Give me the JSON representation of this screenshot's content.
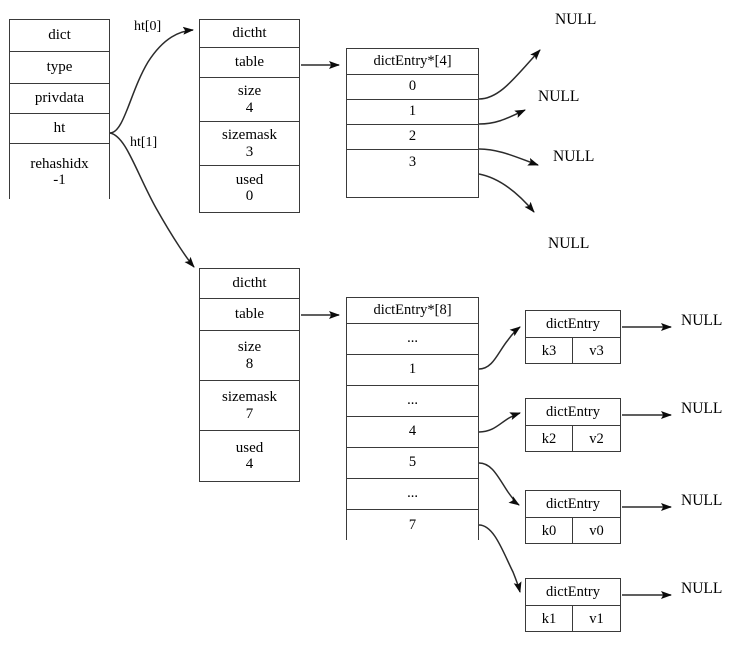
{
  "diagram": {
    "title": "redis dict / dictht / dictEntry structure",
    "stroke_color": "#3a3a3a",
    "background": "#ffffff"
  },
  "dict_struct": {
    "name": "dict",
    "fields": [
      {
        "label": "dict",
        "value": ""
      },
      {
        "label": "type",
        "value": ""
      },
      {
        "label": "privdata",
        "value": ""
      },
      {
        "label": "ht",
        "value": ""
      },
      {
        "label": "rehashidx",
        "value": "-1"
      }
    ]
  },
  "edge_labels": {
    "ht0": "ht[0]",
    "ht1": "ht[1]"
  },
  "hashtables": [
    {
      "name": "dictht",
      "fields": [
        {
          "label": "dictht",
          "value": ""
        },
        {
          "label": "table",
          "value": ""
        },
        {
          "label": "size",
          "value": "4"
        },
        {
          "label": "sizemask",
          "value": "3"
        },
        {
          "label": "used",
          "value": "0"
        }
      ],
      "bucket_table": {
        "header": "dictEntry*[4]",
        "rows": [
          "0",
          "1",
          "2",
          "3"
        ],
        "targets": [
          "NULL",
          "NULL",
          "NULL",
          "NULL"
        ]
      }
    },
    {
      "name": "dictht",
      "fields": [
        {
          "label": "dictht",
          "value": ""
        },
        {
          "label": "table",
          "value": ""
        },
        {
          "label": "size",
          "value": "8"
        },
        {
          "label": "sizemask",
          "value": "7"
        },
        {
          "label": "used",
          "value": "4"
        }
      ],
      "bucket_table": {
        "header": "dictEntry*[8]",
        "rows": [
          "...",
          "1",
          "...",
          "4",
          "5",
          "...",
          "7"
        ]
      }
    }
  ],
  "entries": [
    {
      "header": "dictEntry",
      "key": "k3",
      "value": "v3",
      "next": "NULL"
    },
    {
      "header": "dictEntry",
      "key": "k2",
      "value": "v2",
      "next": "NULL"
    },
    {
      "header": "dictEntry",
      "key": "k0",
      "value": "v0",
      "next": "NULL"
    },
    {
      "header": "dictEntry",
      "key": "k1",
      "value": "v1",
      "next": "NULL"
    }
  ],
  "null_labels": {
    "t4_0": "NULL",
    "t4_1": "NULL",
    "t4_2": "NULL",
    "t4_3": "NULL"
  }
}
